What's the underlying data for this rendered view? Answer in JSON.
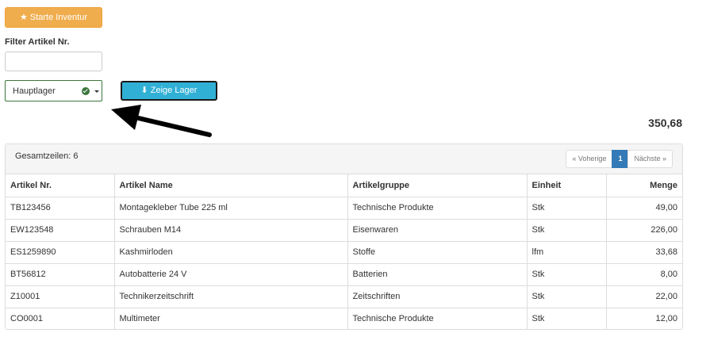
{
  "toolbar": {
    "inventur_label": "Starte Inventur"
  },
  "filter": {
    "label": "Filter Artikel Nr.",
    "value": "",
    "placeholder": ""
  },
  "lager_select": {
    "selected": "Hauptlager"
  },
  "zeige_button": {
    "label": "Zeige Lager"
  },
  "total_value": "350,68",
  "panel": {
    "row_count_label": "Gesamtzeilen: 6",
    "pager": {
      "prev": "« Voherige",
      "current": "1",
      "next": "Nächste »"
    }
  },
  "table": {
    "columns": [
      "Artikel Nr.",
      "Artikel Name",
      "Artikelgruppe",
      "Einheit",
      "Menge"
    ],
    "rows": [
      [
        "TB123456",
        "Montagekleber Tube 225 ml",
        "Technische Produkte",
        "Stk",
        "49,00"
      ],
      [
        "EW123548",
        "Schrauben M14",
        "Eisenwaren",
        "Stk",
        "226,00"
      ],
      [
        "ES1259890",
        "Kashmirloden",
        "Stoffe",
        "lfm",
        "33,68"
      ],
      [
        "BT56812",
        "Autobatterie 24 V",
        "Batterien",
        "Stk",
        "8,00"
      ],
      [
        "Z10001",
        "Technikerzeitschrift",
        "Zeitschriften",
        "Stk",
        "22,00"
      ],
      [
        "CO0001",
        "Multimeter",
        "Technische Produkte",
        "Stk",
        "12,00"
      ]
    ]
  },
  "colors": {
    "warning": "#f0ad4e",
    "info": "#31b0d5",
    "primary": "#337ab7",
    "success": "#3c763d"
  },
  "icons": {
    "inventur": "star-icon",
    "zeige": "download-icon",
    "select_ok": "check-circle-icon",
    "annotation": "arrow-icon"
  }
}
